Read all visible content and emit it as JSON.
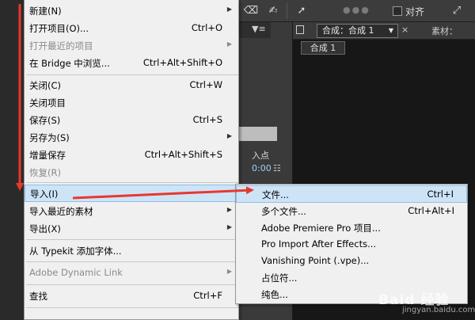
{
  "toolbar": {
    "align_label": "对齐"
  },
  "left_panel": {
    "in_point_label": "入点",
    "timecode": "0:00"
  },
  "composition": {
    "tab_label": "合成：合成 1",
    "footage_tab_label": "素材：",
    "breadcrumb": "合成 1"
  },
  "file_menu": {
    "items": [
      {
        "label": "新建(N)",
        "shortcut": "",
        "submenu": true,
        "disabled": false
      },
      {
        "label": "打开项目(O)...",
        "shortcut": "Ctrl+O",
        "submenu": false,
        "disabled": false
      },
      {
        "label": "打开最近的项目",
        "shortcut": "",
        "submenu": true,
        "disabled": true
      },
      {
        "label": "在 Bridge 中浏览...",
        "shortcut": "Ctrl+Alt+Shift+O",
        "submenu": false,
        "disabled": false
      },
      {
        "label": "关闭(C)",
        "shortcut": "Ctrl+W",
        "submenu": false,
        "disabled": false
      },
      {
        "label": "关闭项目",
        "shortcut": "",
        "submenu": false,
        "disabled": false
      },
      {
        "label": "保存(S)",
        "shortcut": "Ctrl+S",
        "submenu": false,
        "disabled": false
      },
      {
        "label": "另存为(S)",
        "shortcut": "",
        "submenu": true,
        "disabled": false
      },
      {
        "label": "增量保存",
        "shortcut": "Ctrl+Alt+Shift+S",
        "submenu": false,
        "disabled": false
      },
      {
        "label": "恢复(R)",
        "shortcut": "",
        "submenu": false,
        "disabled": true
      },
      {
        "label": "导入(I)",
        "shortcut": "",
        "submenu": true,
        "disabled": false,
        "highlighted": true
      },
      {
        "label": "导入最近的素材",
        "shortcut": "",
        "submenu": true,
        "disabled": false
      },
      {
        "label": "导出(X)",
        "shortcut": "",
        "submenu": true,
        "disabled": false
      },
      {
        "label": "从 Typekit 添加字体...",
        "shortcut": "",
        "submenu": false,
        "disabled": false
      },
      {
        "label": "Adobe Dynamic Link",
        "shortcut": "",
        "submenu": true,
        "disabled": true
      },
      {
        "label": "查找",
        "shortcut": "Ctrl+F",
        "submenu": false,
        "disabled": false
      }
    ]
  },
  "import_submenu": {
    "items": [
      {
        "label": "文件...",
        "shortcut": "Ctrl+I",
        "highlighted": true
      },
      {
        "label": "多个文件...",
        "shortcut": "Ctrl+Alt+I"
      },
      {
        "label": "Adobe Premiere Pro 项目...",
        "shortcut": ""
      },
      {
        "label": "Pro Import After Effects...",
        "shortcut": ""
      },
      {
        "label": "Vanishing Point (.vpe)...",
        "shortcut": ""
      },
      {
        "label": "占位符...",
        "shortcut": ""
      },
      {
        "label": "纯色...",
        "shortcut": ""
      }
    ]
  },
  "watermark": {
    "text": "Baid 经验",
    "sub": "jingyan.baidu.com"
  },
  "colors": {
    "menu_bg": "#f0f0f0",
    "highlight": "#cde4f7",
    "arrow": "#e8382d",
    "app_bg": "#2a2a2a"
  }
}
